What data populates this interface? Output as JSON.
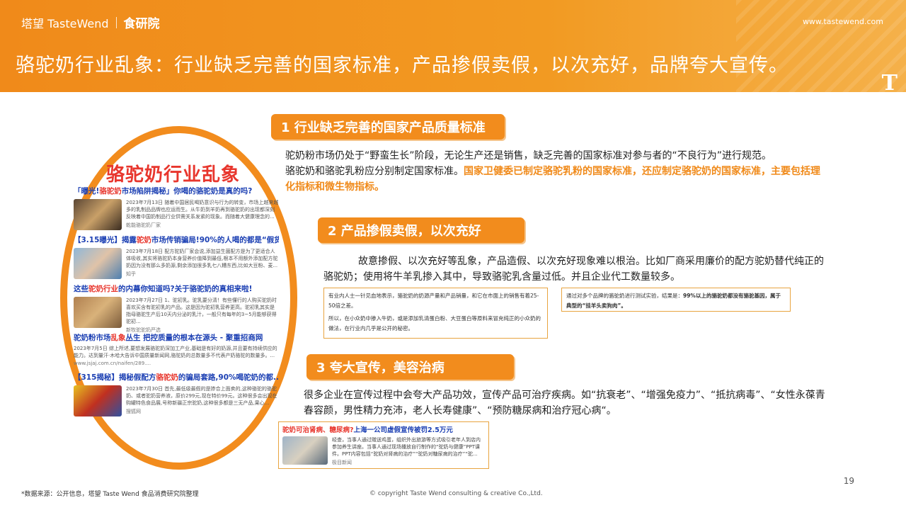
{
  "header": {
    "brand_main": "塔望 TasteWend",
    "brand_sub": "食研院",
    "website": "www.tastewend.com",
    "title": "骆驼奶行业乱象：行业缺乏完善的国家标准，产品掺假卖假，以次充好，品牌夸大宣传。",
    "mark": "T"
  },
  "left_panel": {
    "title": "骆驼奶行业乱象",
    "news": [
      {
        "headline_pre": "「曝光!",
        "headline_red": "骆驼奶",
        "headline_post": "市场陷阱揭秘」你喝的骆驼奶是真的吗?",
        "text": "2023年7月13日 随着中国居民喝奶意识与行为的转变，市场上越来越多的乳制品品牌也应运而生。从牛奶到羊奶再到骆驼奶的出现都深刻反映着中国奶制品行业供需关系发紧的现象。而随着大健康理念的...",
        "source": "乾能骆驼奶厂家"
      },
      {
        "headline_pre": "【3.15曝光】揭露",
        "headline_red": "驼奶",
        "headline_post": "市场传销骗局!90%的人喝的都是“假货...",
        "text": "2023年7月18日 配方驼奶厂家会说,添加益生菌配方是为了更适合人体吸收,其实将骆驼奶本身营养价值降到最低,根本不用额外添加配方驼奶因为没有那么多奶源,剩余添加很多乳七八糟东西,比如大豆粉、麦...",
        "source": "知乎"
      },
      {
        "headline_pre": "这些",
        "headline_red": "驼奶行业",
        "headline_post": "的内幕你知道吗?关于骆驼奶的真相来啦!",
        "text": "2023年7月27日 1、驼初乳。驼乳要分清！有些懂行的人购买驼奶时喜欢买含有驼初乳的产品。这是因为驼初乳营养更高。驼初乳其实是指母骆驼生产后10天内分泌的乳汁，一般只有每年的3~5月能够获得驼初...",
        "source": "新牧驼驼奶严选"
      },
      {
        "headline_pre": "驼奶粉市场",
        "headline_red": "乱象",
        "headline_post": "丛生 把控质量的根本在源头 - 聚重招商网",
        "text": "2023年7月5日 综上所述,要想发展骆驼奶深加工产业,基础是有好的奶源,并且要有持续供应的能力。达到量汗·木哈大告诉中国质量新闻网,骆驼奶的总数量多不代表产奶骆驼的数量多。...",
        "source": "www.jsjaj.com.cn/naifen/289...."
      },
      {
        "headline_pre": "【315揭秘】揭秘假配方",
        "headline_red": "骆驼奶",
        "headline_post": "的骗局套路,90%喝驼奶的都...",
        "text": "2023年7月30日 首先,最低级最假的是掺合上面卖的,这种骆驼的骆驼奶、或者驼奶营养液，原价299元,现在特价99元。这种很多会出现在购罐特色食品展,号称新疆正宗驼奶,这种很多都是三无产品,果心...",
        "source": "搜狐网"
      }
    ]
  },
  "section1": {
    "badge": "1  行业缺乏完善的国家产品质量标准",
    "line1": "驼奶粉市场仍处于“野蛮生长”阶段，无论生产还是销售，缺乏完善的国家标准对参与者的“不良行为”进行规范。",
    "line2_plain": "骆驼奶和骆驼乳粉应分别制定国家标准。",
    "line2_hl": "国家卫健委已制定骆驼乳粉的国家标准，还应制定骆驼奶的国家标准，主要包括理化指标和微生物指标。"
  },
  "section2": {
    "badge": "2  产品掺假卖假，以次充好",
    "para": "故意掺假、以次充好等乱象，产品造假、以次充好现象难以根治。比如厂商采用廉价的配方驼奶替代纯正的骆驼奶；使用将牛羊乳掺入其中，导致骆驼乳含量过低。并且企业代工数量较多。",
    "quote1_a": "有业内人士一针见血地表示，骆驼奶的奶源产量和产品销量，和它在市面上的销售有着25-50倍之差。",
    "quote1_b": "所以，在小众奶中掺入牛奶，或是添加乳清蛋白粉、大豆蛋白等原料来冒充纯正的小众奶的做法，在行业内几乎是公开的秘密。",
    "quote2_plain": "通过对多个品牌的骆驼奶进行测试实验，结果是：",
    "quote2_bold": "99%以上的骆驼奶都没有骆驼基因，属于典型的“挂羊头卖狗肉”。"
  },
  "section3": {
    "badge": "3  夸大宣传，美容治病",
    "para": "很多企业在宣传过程中会夸大产品功效，宣传产品可治疗疾病。如“抗衰老”、“增强免疫力”、“抵抗病毒”、“女性永葆青春容颜，男性精力充沛，老人长寿健康”、“预防糖尿病和治疗冠心病“。",
    "news_pre": "",
    "news_red": "驼奶可治肾病、糖尿病?",
    "news_post": "上海一公司虚假宣传被罚2.5万元",
    "news_text": "经查，当事人通过赠送鸡蛋，组织外出旅游等方式吸引老年人到店内参加养生讲座。当事人通过现场播放自行制作的“驼奶与健康”PPT课件。PPT内容包括“驼奶对肾病的治疗”“驼奶对糖尿病的治疗”“驼...",
    "news_source": "极目新闻"
  },
  "footer": {
    "source": "*数据来源：公开信息，塔望 Taste Wend 食品消费研究院整理",
    "copyright": "© copyright Taste Wend consulting & creative Co.,Ltd.",
    "page": "19"
  },
  "colors": {
    "accent": "#f28c1d",
    "link": "#1b3fb3",
    "red": "#e8362d"
  }
}
